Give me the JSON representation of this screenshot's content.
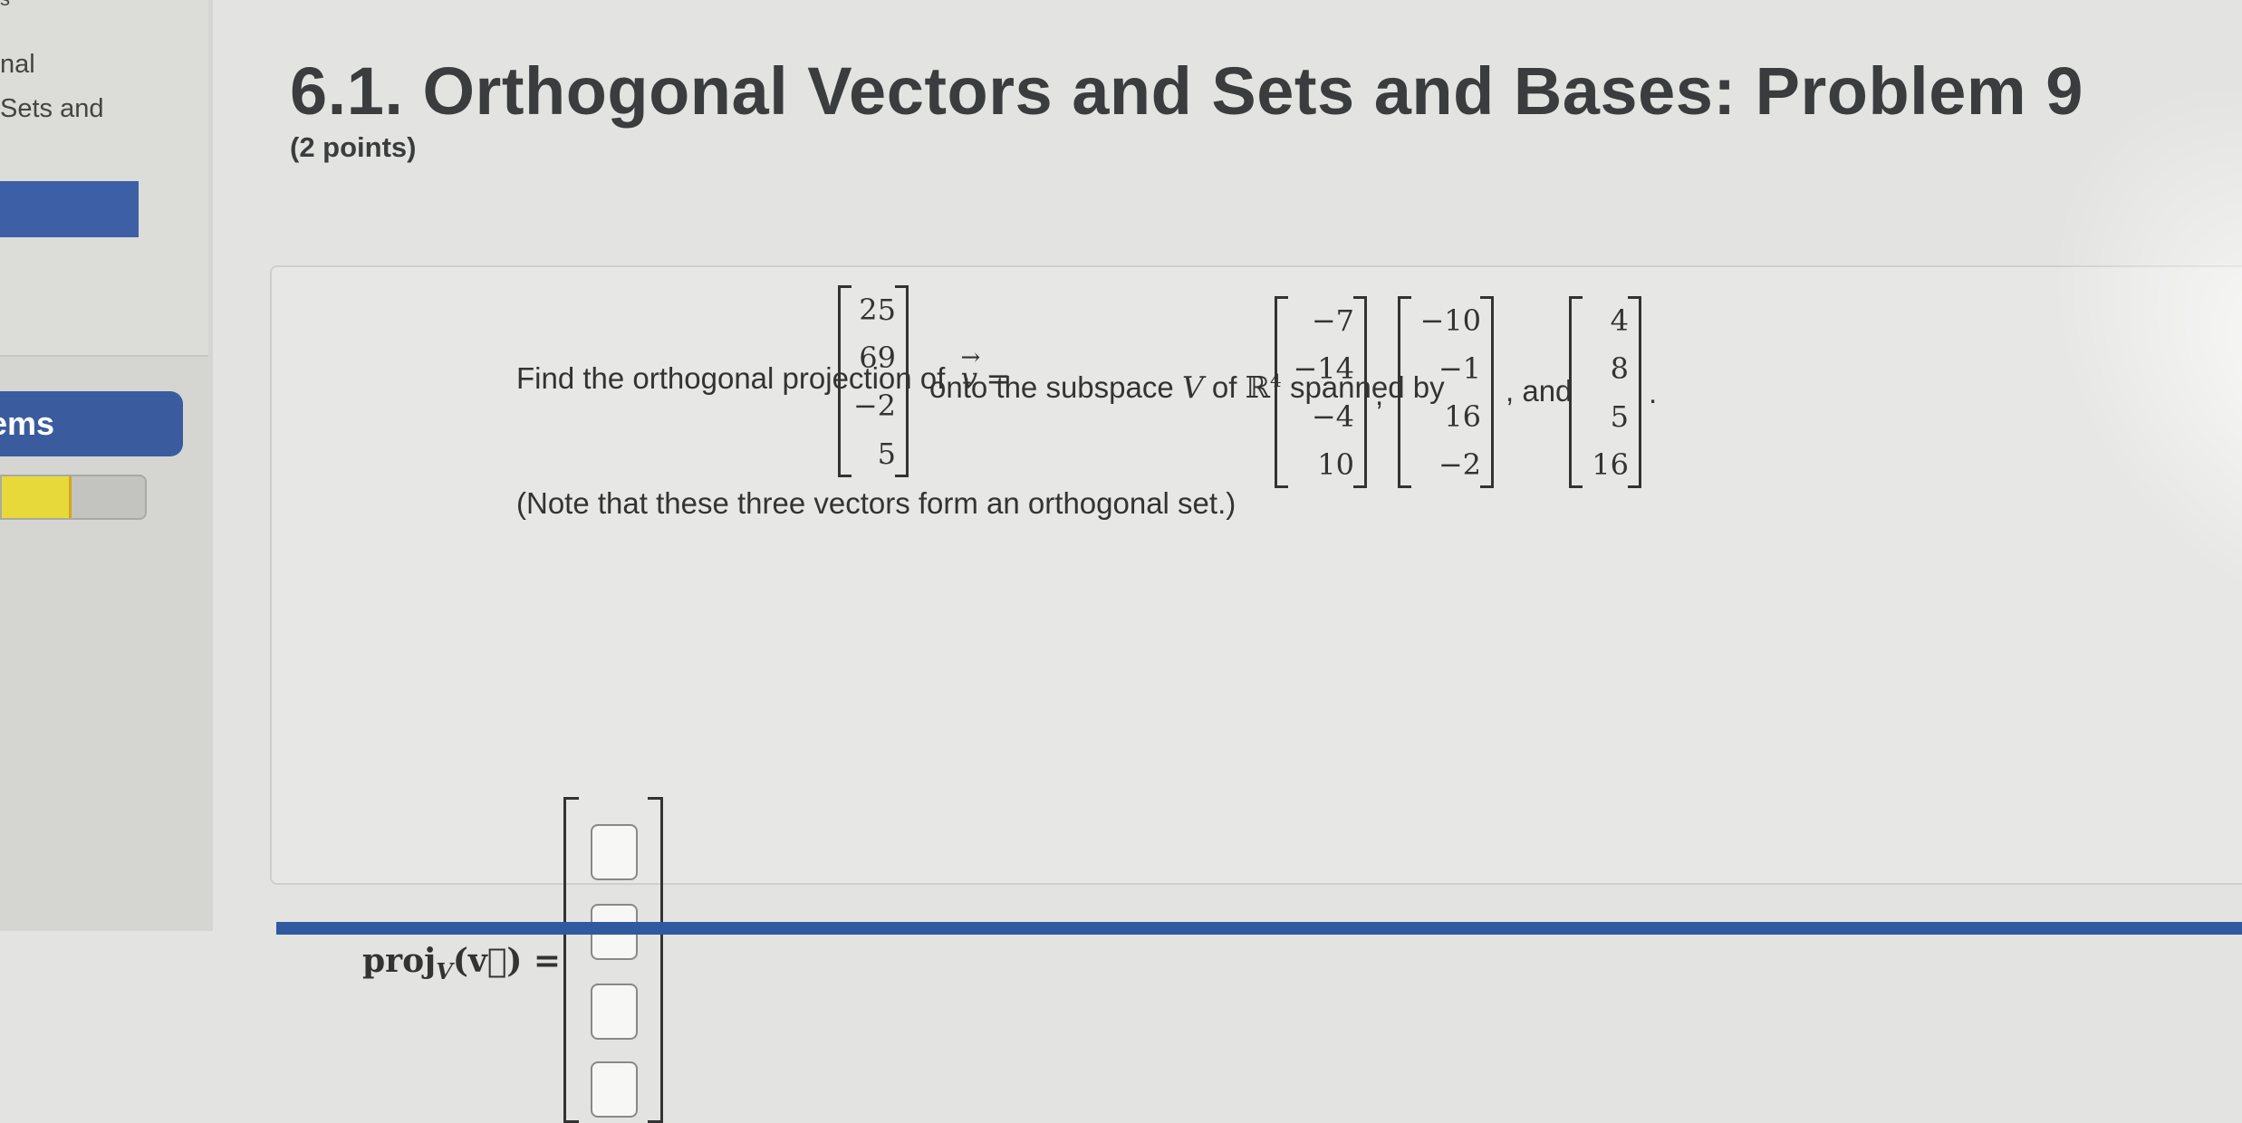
{
  "sidebar": {
    "top_fragment": "s",
    "item_1": "nal",
    "item_2": "Sets and",
    "section_label": "ems",
    "progress_fraction": 0.47
  },
  "header": {
    "title": "6.1. Orthogonal Vectors and Sets and Bases: Problem 9",
    "points": "(2 points)"
  },
  "problem": {
    "text_find": "Find the orthogonal projection of",
    "v_symbol": "v",
    "equals": "=",
    "v_values": [
      "25",
      "69",
      "−2",
      "5"
    ],
    "text_onto": "onto the subspace",
    "V_symbol": "V",
    "text_of": "of",
    "R_symbol": "ℝ",
    "R_power": "4",
    "text_spanned": "spanned by",
    "basis_1": [
      "−7",
      "−14",
      "−4",
      "10"
    ],
    "comma": ",",
    "basis_2": [
      "−10",
      "−1",
      "16",
      "−2"
    ],
    "text_and": ", and",
    "basis_3": [
      "4",
      "8",
      "5",
      "16"
    ],
    "period": ".",
    "note": "(Note that these three vectors form an orthogonal set.)"
  },
  "answer": {
    "label": "proj",
    "subscript": "V",
    "argument": "(v⃗) =",
    "inputs": [
      "",
      "",
      "",
      ""
    ]
  }
}
